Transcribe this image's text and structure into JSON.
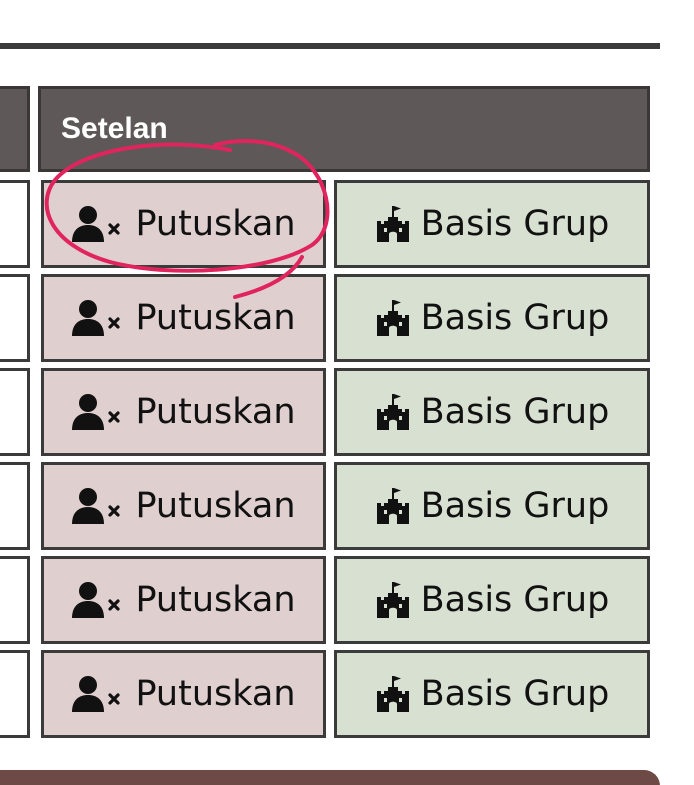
{
  "table": {
    "settings_header": "Setelan",
    "rows": [
      {
        "disconnect_label": "Putuskan",
        "base_label": "Basis Grup"
      },
      {
        "disconnect_label": "Putuskan",
        "base_label": "Basis Grup"
      },
      {
        "disconnect_label": "Putuskan",
        "base_label": "Basis Grup"
      },
      {
        "disconnect_label": "Putuskan",
        "base_label": "Basis Grup"
      },
      {
        "disconnect_label": "Putuskan",
        "base_label": "Basis Grup"
      },
      {
        "disconnect_label": "Putuskan",
        "base_label": "Basis Grup"
      }
    ]
  },
  "icons": {
    "disconnect": "user-remove-icon",
    "base": "castle-icon"
  },
  "colors": {
    "header_bg": "#5e5958",
    "disconnect_bg": "#dfcfcf",
    "base_bg": "#d7e0d1",
    "annotation": "#e0245e",
    "bottom_bar": "#6d4a45"
  }
}
